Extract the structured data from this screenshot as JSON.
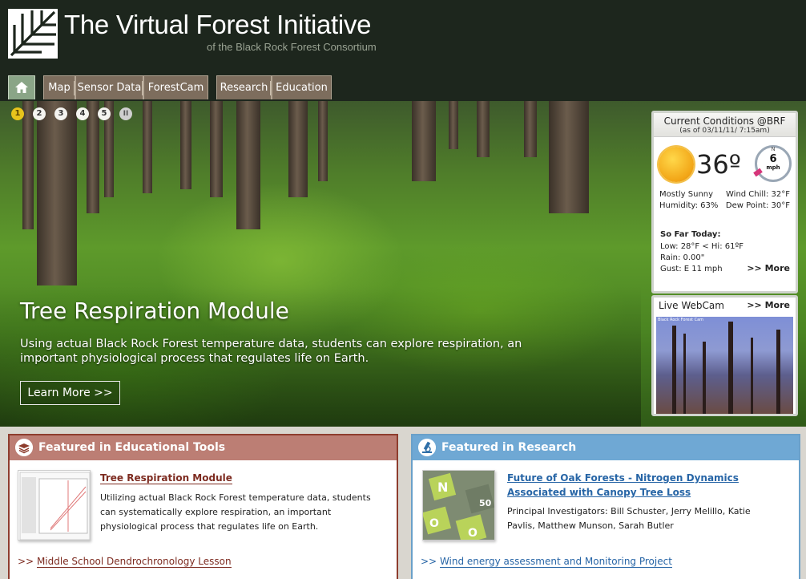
{
  "site": {
    "title": "The Virtual Forest Initiative",
    "subtitle": "of the Black Rock Forest Consortium"
  },
  "nav": {
    "home_icon": "home-icon",
    "tabs": [
      "Map",
      "Sensor Data",
      "ForestCam",
      "Research",
      "Education"
    ]
  },
  "slideshow": {
    "slides": [
      "1",
      "2",
      "3",
      "4",
      "5"
    ],
    "active_slide": 1,
    "pause_symbol": "II",
    "title": "Tree Respiration Module",
    "text": "Using actual Black Rock Forest temperature data, students can explore respiration, an important physiological process that regulates life on Earth.",
    "button": "Learn More >>"
  },
  "conditions": {
    "title": "Current Conditions @BRF",
    "as_of": "(as of 03/11/11/ 7:15am)",
    "temperature": "36º",
    "wind_speed": "6",
    "wind_unit": "mph",
    "compass_n": "N",
    "sky": "Mostly Sunny",
    "wind_chill": "Wind Chill: 32°F",
    "humidity": "Humidity: 63%",
    "dew_point": "Dew Point: 30°F",
    "so_far_label": "So Far Today:",
    "low_high": "Low: 28°F  <  Hi: 61ºF",
    "rain": "Rain: 0.00\"",
    "gust": "Gust: E 11 mph",
    "more": ">> More"
  },
  "webcam": {
    "title": "Live WebCam",
    "more": ">> More",
    "stamp": "Black Rock Forest Cam"
  },
  "featured_edu": {
    "title": "Featured in Educational Tools",
    "article_title": "Tree Respiration Module",
    "article_text": "Utilizing actual Black Rock Forest temperature data, students can systematically explore respiration, an important physiological process that regulates life on Earth.",
    "more_prefix": ">>",
    "more_link": "Middle School Dendrochronology Lesson"
  },
  "featured_research": {
    "title": "Featured in Research",
    "article_title": "Future of Oak Forests - Nitrogen Dynamics Associated with Canopy Tree Loss",
    "article_text": "Principal Investigators: Bill Schuster, Jerry Melillo, Katie Pavlis, Matthew Munson, Sarah Butler",
    "more_prefix": ">>",
    "more_link": "Wind energy assessment and Monitoring Project",
    "thumb_letters": [
      "N",
      "O",
      "50",
      "O"
    ]
  },
  "colors": {
    "header_bg": "#1d261d",
    "tab_bg": "#7d6d5d",
    "edu_accent": "#8e3d2e",
    "research_accent": "#6aa0c9",
    "link_red": "#7d2b20",
    "link_blue": "#2765a6"
  }
}
